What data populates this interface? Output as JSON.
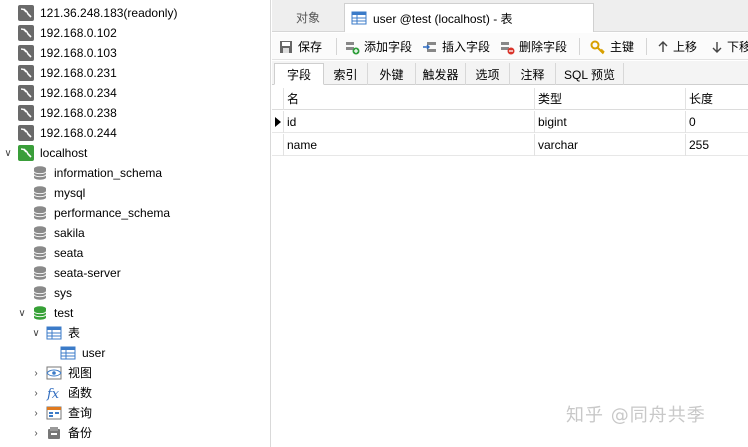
{
  "tree": {
    "connections": [
      {
        "label": "121.36.248.183(readonly)"
      },
      {
        "label": "192.168.0.102"
      },
      {
        "label": "192.168.0.103"
      },
      {
        "label": "192.168.0.231"
      },
      {
        "label": "192.168.0.234"
      },
      {
        "label": "192.168.0.238"
      },
      {
        "label": "192.168.0.244"
      }
    ],
    "localhost": "localhost",
    "databases": [
      "information_schema",
      "mysql",
      "performance_schema",
      "sakila",
      "seata",
      "seata-server",
      "sys"
    ],
    "test_db": "test",
    "tables_folder": "表",
    "table_user": "user",
    "views_folder": "视图",
    "functions_folder": "函数",
    "queries_folder": "查询",
    "backups_folder": "备份"
  },
  "tabs": {
    "objects": "对象",
    "active": "user @test (localhost) - 表"
  },
  "toolbar": {
    "save": "保存",
    "add_field": "添加字段",
    "insert_field": "插入字段",
    "delete_field": "删除字段",
    "primary_key": "主键",
    "move_up": "上移",
    "move_down": "下移"
  },
  "subtabs": [
    "字段",
    "索引",
    "外键",
    "触发器",
    "选项",
    "注释",
    "SQL 预览"
  ],
  "grid": {
    "headers": [
      "名",
      "类型",
      "长度"
    ],
    "rows": [
      {
        "name": "id",
        "type": "bigint",
        "length": "0"
      },
      {
        "name": "name",
        "type": "varchar",
        "length": "255"
      }
    ]
  },
  "watermark": "知乎 @同舟共季",
  "colors": {
    "connection_icon": "#6a6a6a",
    "active_connection_icon": "#3a9e3a",
    "tab_bar": "#eeeeee"
  }
}
